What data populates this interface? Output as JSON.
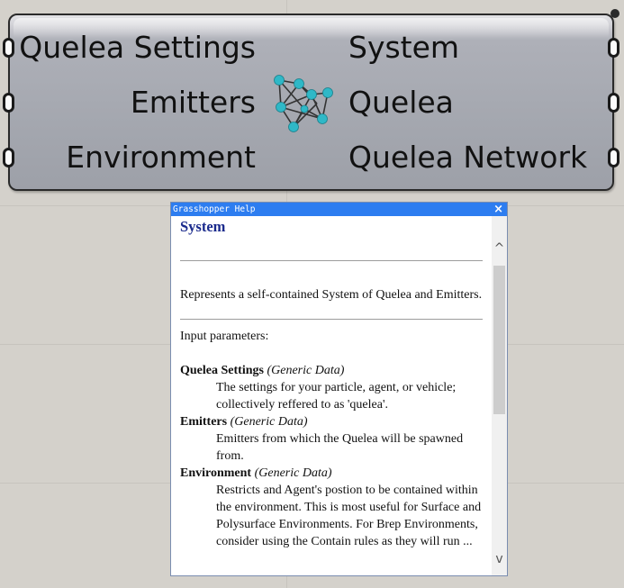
{
  "component": {
    "inputs": [
      "Quelea Settings",
      "Emitters",
      "Environment"
    ],
    "outputs": [
      "System",
      "Quelea",
      "Quelea Network"
    ],
    "icon": "quelea-network-icon"
  },
  "help": {
    "title": "Grasshopper Help",
    "close": "×",
    "heading": "System",
    "description": "Represents a self-contained System of Quelea and Emitters.",
    "inputs_header": "Input parameters:",
    "params": [
      {
        "name": "Quelea Settings",
        "type": "(Generic Data)",
        "desc": "The settings for your particle, agent, or vehicle; collectively reffered to as 'quelea'."
      },
      {
        "name": "Emitters",
        "type": "(Generic Data)",
        "desc": "Emitters from which the Quelea will be spawned from."
      },
      {
        "name": "Environment",
        "type": "(Generic Data)",
        "desc": "Restricts and Agent's postion to be contained within the environment. This is most useful for Surface and Polysurface Environments. For Brep Environments, consider using the Contain rules as they will run ..."
      }
    ],
    "scroll_up": "^",
    "scroll_down": "v"
  }
}
